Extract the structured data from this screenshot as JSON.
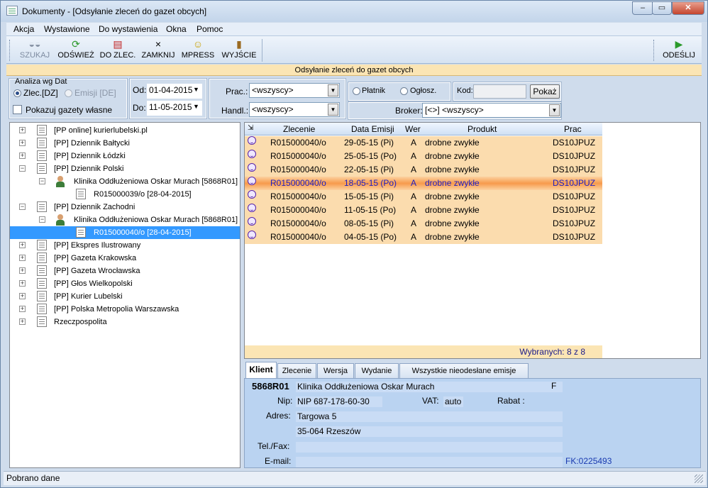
{
  "window": {
    "title": "Dokumenty - [Odsyłanie zleceń do gazet obcych]",
    "btn_min": "–",
    "btn_restore": "▭",
    "btn_close": "✕"
  },
  "menu": [
    "Akcja",
    "Wystawione",
    "Do wystawienia",
    "Okna",
    "Pomoc"
  ],
  "toolbar": {
    "szukaj": "SZUKAJ",
    "odswiez": "ODŚWIEŻ",
    "do_zlec": "DO ZLEC.",
    "zamknij": "ZAMKNIJ",
    "mpress": "MPRESS",
    "wyjscie": "WYJŚCIE",
    "odeslij": "ODEŚLIJ"
  },
  "band": "Odsyłanie zleceń do gazet obcych",
  "filters": {
    "analiza_label": "Analiza wg Dat",
    "zlec": "Zlec.[DZ]",
    "emisji": "Emisji [DE]",
    "pokazuj": "Pokazuj gazety własne",
    "od_label": "Od:",
    "od_value": "01-04-2015",
    "do_label": "Do:",
    "do_value": "11-05-2015",
    "prac_label": "Prac.:",
    "prac_value": "<wszyscy>",
    "handl_label": "Handl.:",
    "handl_value": "<wszyscy>",
    "platnik": "Płatnik",
    "oglosz": "Ogłosz.",
    "kod_label": "Kod:",
    "pokaz": "Pokaż",
    "broker_label": "Broker:",
    "broker_value": "[<>] <wszyscy>"
  },
  "tree": [
    {
      "label": "[PP online] kurierlubelski.pl"
    },
    {
      "label": "[PP] Dziennik Bałtycki"
    },
    {
      "label": "[PP] Dziennik Łódzki"
    },
    {
      "label": "[PP] Dziennik Polski"
    },
    {
      "label": "Klinika Oddłużeniowa Oskar Murach [5868R01]"
    },
    {
      "label": "R015000039/o [28-04-2015]"
    },
    {
      "label": "[PP] Dziennik Zachodni"
    },
    {
      "label": "Klinika Oddłużeniowa Oskar Murach [5868R01]"
    },
    {
      "label": "R015000040/o [28-04-2015]"
    },
    {
      "label": "[PP] Ekspres Ilustrowany"
    },
    {
      "label": "[PP] Gazeta Krakowska"
    },
    {
      "label": "[PP] Gazeta Wrocławska"
    },
    {
      "label": "[PP] Głos Wielkopolski"
    },
    {
      "label": "[PP] Kurier Lubelski"
    },
    {
      "label": "[PP] Polska Metropolia Warszawska"
    },
    {
      "label": "Rzeczpospolita"
    }
  ],
  "grid": {
    "headers": [
      "Zlecenie",
      "Data Emisji",
      "Wer",
      "Produkt",
      "Prac"
    ],
    "rows": [
      [
        "R015000040/o",
        "29-05-15 (Pi)",
        "A",
        "drobne zwykłe",
        "DS10JPUZ"
      ],
      [
        "R015000040/o",
        "25-05-15 (Po)",
        "A",
        "drobne zwykłe",
        "DS10JPUZ"
      ],
      [
        "R015000040/o",
        "22-05-15 (Pi)",
        "A",
        "drobne zwykłe",
        "DS10JPUZ"
      ],
      [
        "R015000040/o",
        "18-05-15 (Po)",
        "A",
        "drobne zwykłe",
        "DS10JPUZ"
      ],
      [
        "R015000040/o",
        "15-05-15 (Pi)",
        "A",
        "drobne zwykłe",
        "DS10JPUZ"
      ],
      [
        "R015000040/o",
        "11-05-15 (Po)",
        "A",
        "drobne zwykłe",
        "DS10JPUZ"
      ],
      [
        "R015000040/o",
        "08-05-15 (Pi)",
        "A",
        "drobne zwykłe",
        "DS10JPUZ"
      ],
      [
        "R015000040/o",
        "04-05-15 (Po)",
        "A",
        "drobne zwykłe",
        "DS10JPUZ"
      ]
    ],
    "footer": "Wybranych: 8 z 8"
  },
  "tabs": [
    "Klient",
    "Zlecenie",
    "Wersja",
    "Wydanie",
    "Wszystkie nieodesłane emisje"
  ],
  "client": {
    "code": "5868R01",
    "name": "Klinika Oddłużeniowa Oskar Murach",
    "type": "F",
    "nip_label": "Nip:",
    "nip": "NIP 687-178-60-30",
    "vat_label": "VAT:",
    "vat": "auto",
    "rabat_label": "Rabat :",
    "adres_label": "Adres:",
    "adres1": "Targowa 5",
    "adres2": "35-064 Rzeszów",
    "tel_label": "Tel./Fax:",
    "email_label": "E-mail:",
    "fk": "FK:0225493"
  },
  "status": "Pobrano dane"
}
